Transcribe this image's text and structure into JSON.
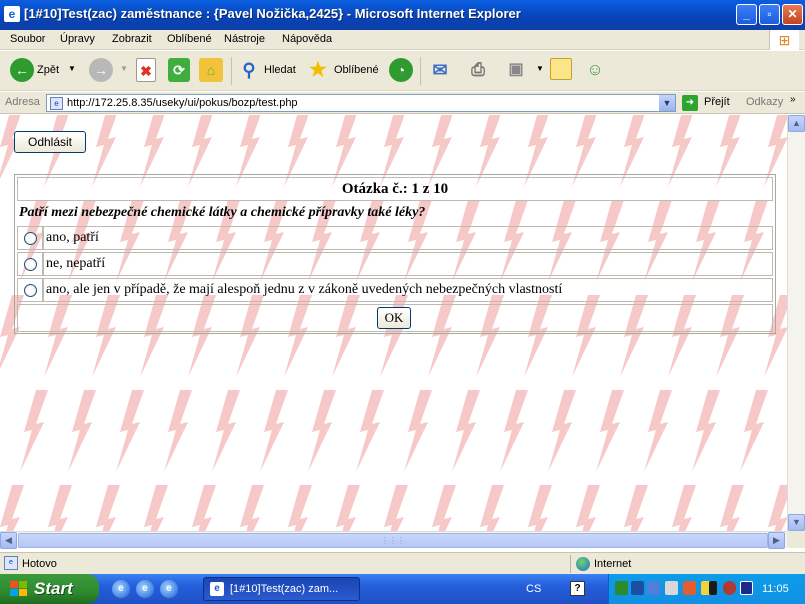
{
  "window": {
    "title": "[1#10]Test(zac) zaměstnance : {Pavel Nožička,2425} - Microsoft Internet Explorer"
  },
  "menu": [
    "Soubor",
    "Úpravy",
    "Zobrazit",
    "Oblíbené",
    "Nástroje",
    "Nápověda"
  ],
  "toolbar": {
    "back": "Zpět",
    "search": "Hledat",
    "favorites": "Oblíbené"
  },
  "address": {
    "label": "Adresa",
    "url": "http://172.25.8.35/useky/ui/pokus/bozp/test.php",
    "go": "Přejít",
    "links": "Odkazy"
  },
  "page": {
    "logout": "Odhlásit",
    "counter": "Otázka č.: 1 z 10",
    "question": "Patří mezi nebezpečné chemické látky a chemické přípravky také léky?",
    "answers": [
      "ano, patří",
      "ne, nepatří",
      "ano, ale jen v případě, že mají alespoň jednu z v zákoně uvedených nebezpečných vlastností"
    ],
    "ok": "OK"
  },
  "status": {
    "text": "Hotovo",
    "zone": "Internet"
  },
  "taskbar": {
    "start": "Start",
    "item": "[1#10]Test(zac) zam...",
    "lang": "CS",
    "clock": "11:05"
  },
  "colors": {
    "titlebar": "#0842b8",
    "background_bolt": "#f6c8c8",
    "taskbar": "#245edb",
    "start": "#2f8a2f"
  }
}
